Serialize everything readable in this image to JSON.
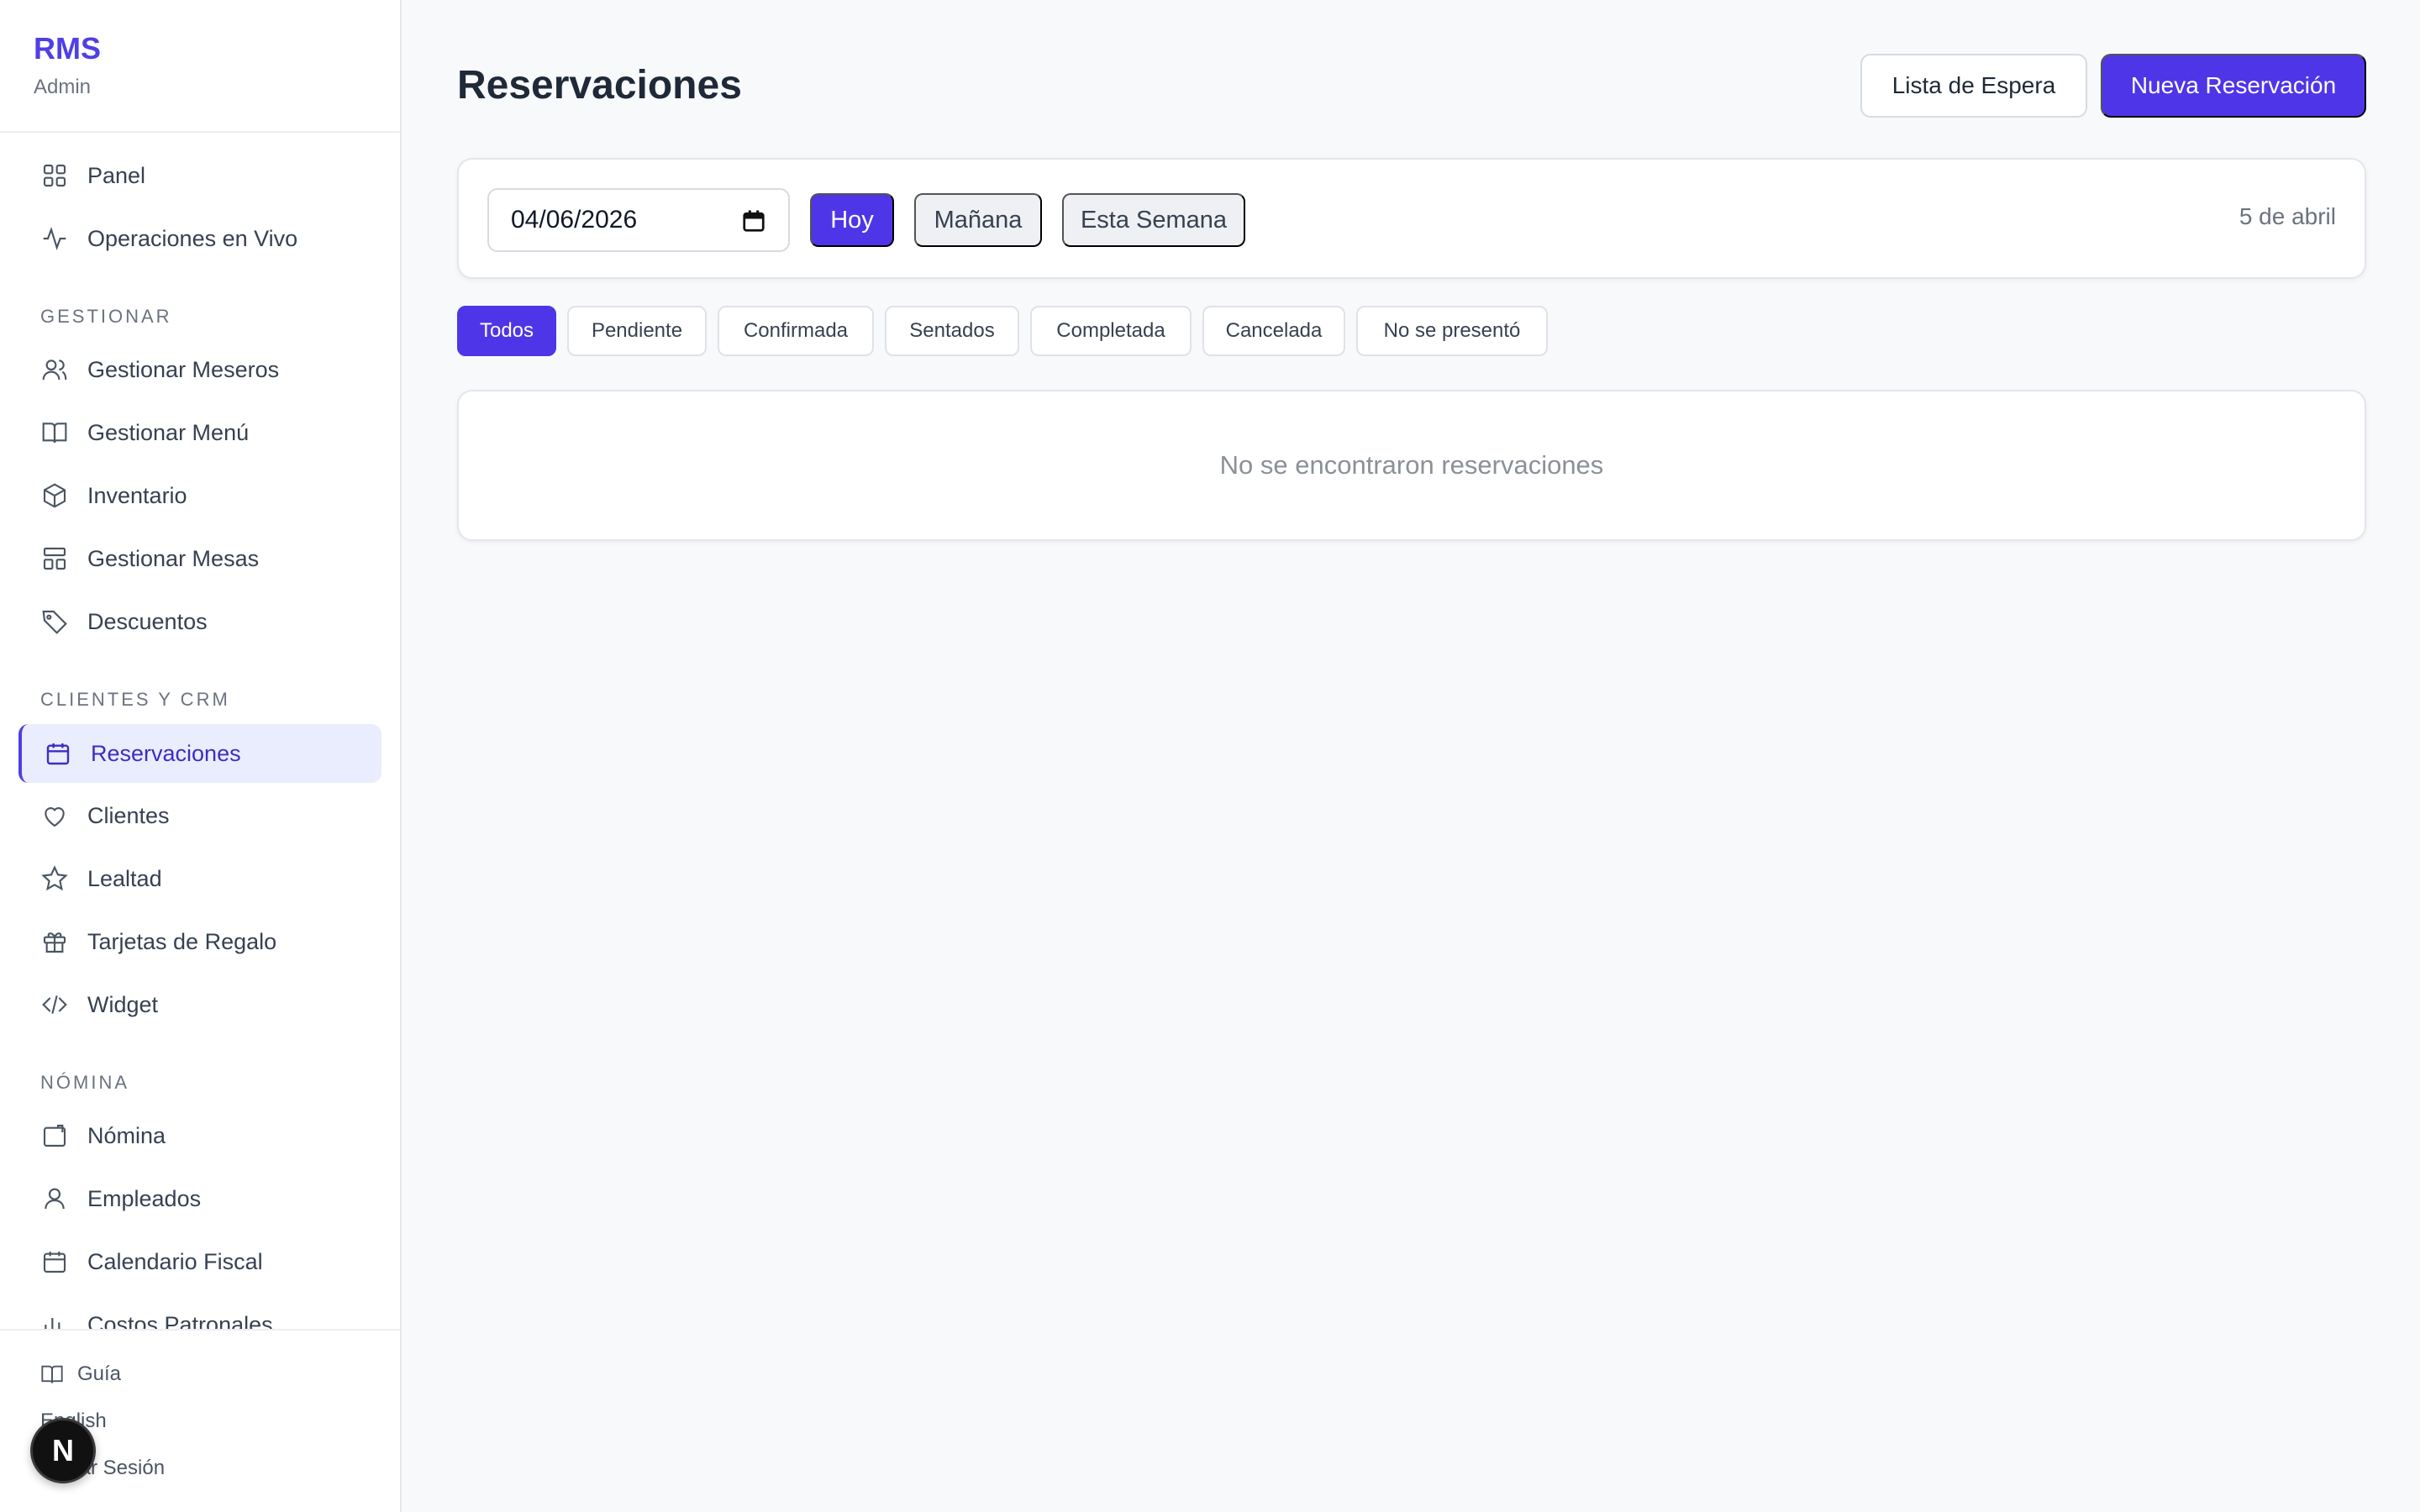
{
  "brand": {
    "title": "RMS",
    "subtitle": "Admin"
  },
  "nav": {
    "top": [
      {
        "label": "Panel",
        "icon": "grid-icon"
      },
      {
        "label": "Operaciones en Vivo",
        "icon": "activity-icon"
      }
    ],
    "sections": [
      {
        "label": "GESTIONAR",
        "items": [
          {
            "label": "Gestionar Meseros",
            "icon": "users-icon"
          },
          {
            "label": "Gestionar Menú",
            "icon": "book-open-icon"
          },
          {
            "label": "Inventario",
            "icon": "box-icon"
          },
          {
            "label": "Gestionar Mesas",
            "icon": "tables-icon"
          },
          {
            "label": "Descuentos",
            "icon": "tag-icon"
          }
        ]
      },
      {
        "label": "CLIENTES Y CRM",
        "items": [
          {
            "label": "Reservaciones",
            "icon": "calendar-icon",
            "active": true
          },
          {
            "label": "Clientes",
            "icon": "heart-icon"
          },
          {
            "label": "Lealtad",
            "icon": "star-icon"
          },
          {
            "label": "Tarjetas de Regalo",
            "icon": "gift-icon"
          },
          {
            "label": "Widget",
            "icon": "code-icon"
          }
        ]
      },
      {
        "label": "NÓMINA",
        "items": [
          {
            "label": "Nómina",
            "icon": "wallet-icon"
          },
          {
            "label": "Empleados",
            "icon": "user-icon"
          },
          {
            "label": "Calendario Fiscal",
            "icon": "calendar-icon"
          },
          {
            "label": "Costos Patronales",
            "icon": "bar-chart-icon"
          }
        ]
      }
    ],
    "footer": {
      "guide": "Guía",
      "language": "English",
      "logout": "Cerrar Sesión",
      "badge": "N"
    }
  },
  "page": {
    "title": "Reservaciones",
    "waitlist_button": "Lista de Espera",
    "new_button": "Nueva Reservación"
  },
  "date_bar": {
    "date_value": "04/06/2026",
    "today": "Hoy",
    "tomorrow": "Mañana",
    "this_week": "Esta Semana",
    "date_label": "5 de abril"
  },
  "filters": [
    "Todos",
    "Pendiente",
    "Confirmada",
    "Sentados",
    "Completada",
    "Cancelada",
    "No se presentó"
  ],
  "empty_message": "No se encontraron reservaciones",
  "colors": {
    "accent": "#4f35e8",
    "active_bg": "#eaedfd",
    "background": "#f8f9fb"
  }
}
